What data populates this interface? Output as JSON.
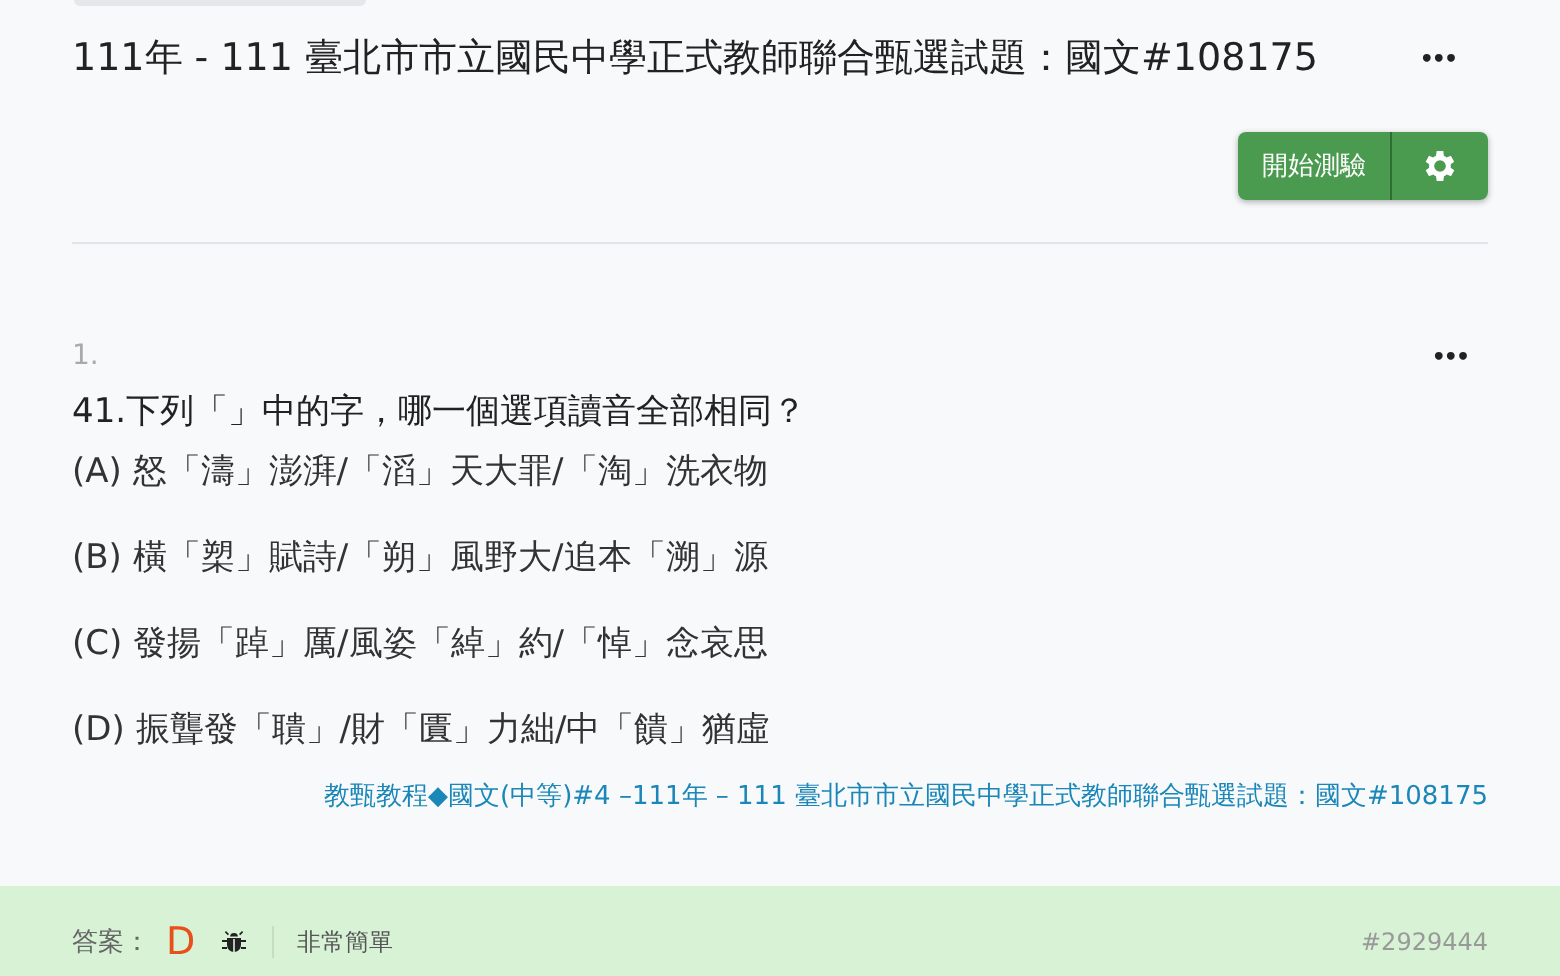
{
  "header": {
    "title": "111年 - 111 臺北市市立國民中學正式教師聯合甄選試題：國文#108175",
    "more": "•••",
    "start_button": "開始測驗"
  },
  "question": {
    "number": "1.",
    "more": "•••",
    "text": "41.下列「」中的字，哪一個選項讀音全部相同？",
    "options": [
      {
        "text": "(A) 怒「濤」澎湃/「滔」天大罪/「淘」洗衣物"
      },
      {
        "text": "(B) 橫「槊」賦詩/「朔」風野大/追本「溯」源"
      },
      {
        "text": "(C) 發揚「踔」厲/風姿「綽」約/「悼」念哀思"
      },
      {
        "text": "(D) 振聾發「聵」/財「匱」力絀/中「饋」猶虛"
      }
    ],
    "source": "教甄教程◆國文(中等)#4 –111年 – 111 臺北市市立國民中學正式教師聯合甄選試題：國文#108175"
  },
  "answer_bar": {
    "label": "答案：",
    "answer": "D",
    "difficulty": "非常簡單",
    "id": "#2929444"
  }
}
